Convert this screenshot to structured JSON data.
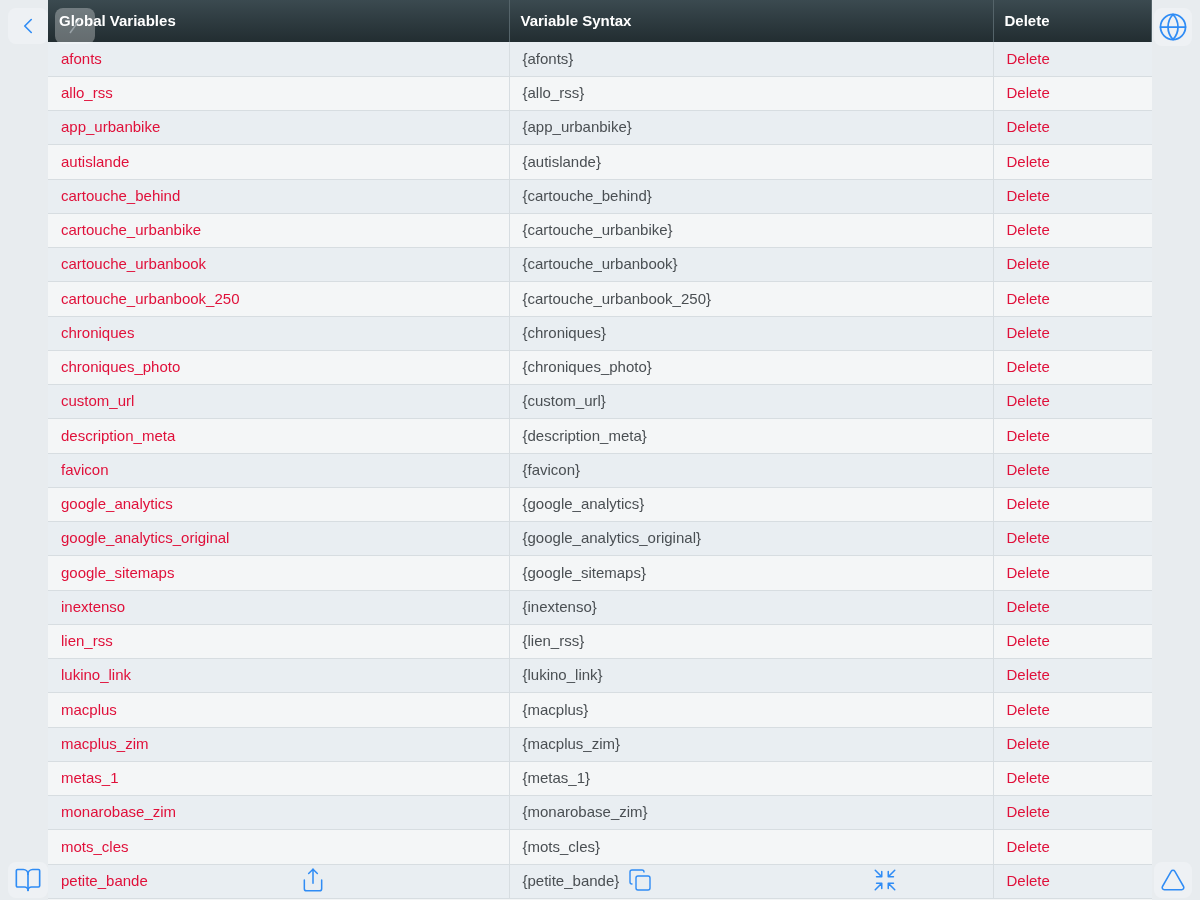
{
  "table": {
    "columns": [
      "Global Variables",
      "Variable Syntax",
      "Delete"
    ],
    "rows": [
      {
        "name": "afonts",
        "syntax": "{afonts}",
        "action": "Delete"
      },
      {
        "name": "allo_rss",
        "syntax": "{allo_rss}",
        "action": "Delete"
      },
      {
        "name": "app_urbanbike",
        "syntax": "{app_urbanbike}",
        "action": "Delete"
      },
      {
        "name": "autislande",
        "syntax": "{autislande}",
        "action": "Delete"
      },
      {
        "name": "cartouche_behind",
        "syntax": "{cartouche_behind}",
        "action": "Delete"
      },
      {
        "name": "cartouche_urbanbike",
        "syntax": "{cartouche_urbanbike}",
        "action": "Delete"
      },
      {
        "name": "cartouche_urbanbook",
        "syntax": "{cartouche_urbanbook}",
        "action": "Delete"
      },
      {
        "name": "cartouche_urbanbook_250",
        "syntax": "{cartouche_urbanbook_250}",
        "action": "Delete"
      },
      {
        "name": "chroniques",
        "syntax": "{chroniques}",
        "action": "Delete"
      },
      {
        "name": "chroniques_photo",
        "syntax": "{chroniques_photo}",
        "action": "Delete"
      },
      {
        "name": "custom_url",
        "syntax": "{custom_url}",
        "action": "Delete"
      },
      {
        "name": "description_meta",
        "syntax": "{description_meta}",
        "action": "Delete"
      },
      {
        "name": "favicon",
        "syntax": "{favicon}",
        "action": "Delete"
      },
      {
        "name": "google_analytics",
        "syntax": "{google_analytics}",
        "action": "Delete"
      },
      {
        "name": "google_analytics_original",
        "syntax": "{google_analytics_original}",
        "action": "Delete"
      },
      {
        "name": "google_sitemaps",
        "syntax": "{google_sitemaps}",
        "action": "Delete"
      },
      {
        "name": "inextenso",
        "syntax": "{inextenso}",
        "action": "Delete"
      },
      {
        "name": "lien_rss",
        "syntax": "{lien_rss}",
        "action": "Delete"
      },
      {
        "name": "lukino_link",
        "syntax": "{lukino_link}",
        "action": "Delete"
      },
      {
        "name": "macplus",
        "syntax": "{macplus}",
        "action": "Delete"
      },
      {
        "name": "macplus_zim",
        "syntax": "{macplus_zim}",
        "action": "Delete"
      },
      {
        "name": "metas_1",
        "syntax": "{metas_1}",
        "action": "Delete"
      },
      {
        "name": "monarobase_zim",
        "syntax": "{monarobase_zim}",
        "action": "Delete"
      },
      {
        "name": "mots_cles",
        "syntax": "{mots_cles}",
        "action": "Delete"
      },
      {
        "name": "petite_bande",
        "syntax": "{petite_bande}",
        "action": "Delete"
      }
    ]
  }
}
